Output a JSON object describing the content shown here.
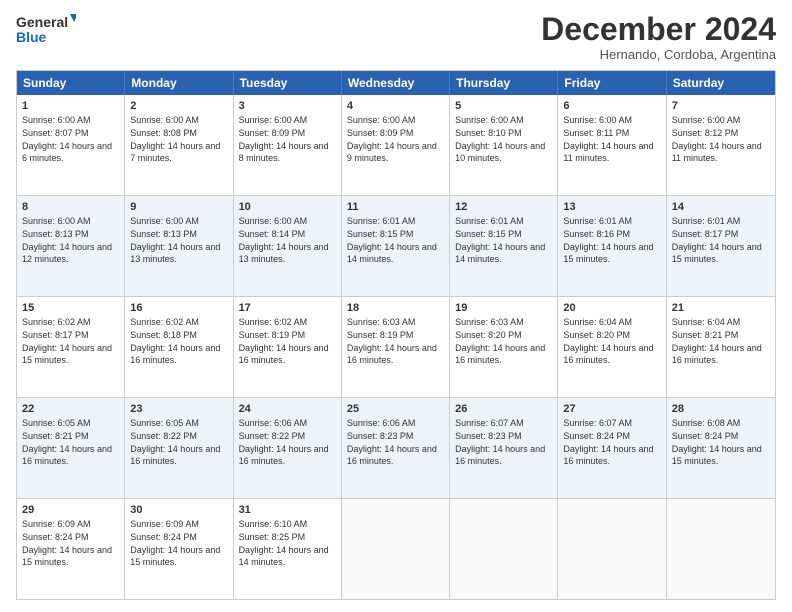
{
  "logo": {
    "line1": "General",
    "line2": "Blue"
  },
  "title": "December 2024",
  "location": "Hernando, Cordoba, Argentina",
  "days_of_week": [
    "Sunday",
    "Monday",
    "Tuesday",
    "Wednesday",
    "Thursday",
    "Friday",
    "Saturday"
  ],
  "weeks": [
    [
      {
        "day": "1",
        "sunrise": "6:00 AM",
        "sunset": "8:07 PM",
        "daylight": "14 hours and 6 minutes."
      },
      {
        "day": "2",
        "sunrise": "6:00 AM",
        "sunset": "8:08 PM",
        "daylight": "14 hours and 7 minutes."
      },
      {
        "day": "3",
        "sunrise": "6:00 AM",
        "sunset": "8:09 PM",
        "daylight": "14 hours and 8 minutes."
      },
      {
        "day": "4",
        "sunrise": "6:00 AM",
        "sunset": "8:09 PM",
        "daylight": "14 hours and 9 minutes."
      },
      {
        "day": "5",
        "sunrise": "6:00 AM",
        "sunset": "8:10 PM",
        "daylight": "14 hours and 10 minutes."
      },
      {
        "day": "6",
        "sunrise": "6:00 AM",
        "sunset": "8:11 PM",
        "daylight": "14 hours and 11 minutes."
      },
      {
        "day": "7",
        "sunrise": "6:00 AM",
        "sunset": "8:12 PM",
        "daylight": "14 hours and 11 minutes."
      }
    ],
    [
      {
        "day": "8",
        "sunrise": "6:00 AM",
        "sunset": "8:13 PM",
        "daylight": "14 hours and 12 minutes."
      },
      {
        "day": "9",
        "sunrise": "6:00 AM",
        "sunset": "8:13 PM",
        "daylight": "14 hours and 13 minutes."
      },
      {
        "day": "10",
        "sunrise": "6:00 AM",
        "sunset": "8:14 PM",
        "daylight": "14 hours and 13 minutes."
      },
      {
        "day": "11",
        "sunrise": "6:01 AM",
        "sunset": "8:15 PM",
        "daylight": "14 hours and 14 minutes."
      },
      {
        "day": "12",
        "sunrise": "6:01 AM",
        "sunset": "8:15 PM",
        "daylight": "14 hours and 14 minutes."
      },
      {
        "day": "13",
        "sunrise": "6:01 AM",
        "sunset": "8:16 PM",
        "daylight": "14 hours and 15 minutes."
      },
      {
        "day": "14",
        "sunrise": "6:01 AM",
        "sunset": "8:17 PM",
        "daylight": "14 hours and 15 minutes."
      }
    ],
    [
      {
        "day": "15",
        "sunrise": "6:02 AM",
        "sunset": "8:17 PM",
        "daylight": "14 hours and 15 minutes."
      },
      {
        "day": "16",
        "sunrise": "6:02 AM",
        "sunset": "8:18 PM",
        "daylight": "14 hours and 16 minutes."
      },
      {
        "day": "17",
        "sunrise": "6:02 AM",
        "sunset": "8:19 PM",
        "daylight": "14 hours and 16 minutes."
      },
      {
        "day": "18",
        "sunrise": "6:03 AM",
        "sunset": "8:19 PM",
        "daylight": "14 hours and 16 minutes."
      },
      {
        "day": "19",
        "sunrise": "6:03 AM",
        "sunset": "8:20 PM",
        "daylight": "14 hours and 16 minutes."
      },
      {
        "day": "20",
        "sunrise": "6:04 AM",
        "sunset": "8:20 PM",
        "daylight": "14 hours and 16 minutes."
      },
      {
        "day": "21",
        "sunrise": "6:04 AM",
        "sunset": "8:21 PM",
        "daylight": "14 hours and 16 minutes."
      }
    ],
    [
      {
        "day": "22",
        "sunrise": "6:05 AM",
        "sunset": "8:21 PM",
        "daylight": "14 hours and 16 minutes."
      },
      {
        "day": "23",
        "sunrise": "6:05 AM",
        "sunset": "8:22 PM",
        "daylight": "14 hours and 16 minutes."
      },
      {
        "day": "24",
        "sunrise": "6:06 AM",
        "sunset": "8:22 PM",
        "daylight": "14 hours and 16 minutes."
      },
      {
        "day": "25",
        "sunrise": "6:06 AM",
        "sunset": "8:23 PM",
        "daylight": "14 hours and 16 minutes."
      },
      {
        "day": "26",
        "sunrise": "6:07 AM",
        "sunset": "8:23 PM",
        "daylight": "14 hours and 16 minutes."
      },
      {
        "day": "27",
        "sunrise": "6:07 AM",
        "sunset": "8:24 PM",
        "daylight": "14 hours and 16 minutes."
      },
      {
        "day": "28",
        "sunrise": "6:08 AM",
        "sunset": "8:24 PM",
        "daylight": "14 hours and 15 minutes."
      }
    ],
    [
      {
        "day": "29",
        "sunrise": "6:09 AM",
        "sunset": "8:24 PM",
        "daylight": "14 hours and 15 minutes."
      },
      {
        "day": "30",
        "sunrise": "6:09 AM",
        "sunset": "8:24 PM",
        "daylight": "14 hours and 15 minutes."
      },
      {
        "day": "31",
        "sunrise": "6:10 AM",
        "sunset": "8:25 PM",
        "daylight": "14 hours and 14 minutes."
      },
      {
        "day": "",
        "sunrise": "",
        "sunset": "",
        "daylight": ""
      },
      {
        "day": "",
        "sunrise": "",
        "sunset": "",
        "daylight": ""
      },
      {
        "day": "",
        "sunrise": "",
        "sunset": "",
        "daylight": ""
      },
      {
        "day": "",
        "sunrise": "",
        "sunset": "",
        "daylight": ""
      }
    ]
  ]
}
